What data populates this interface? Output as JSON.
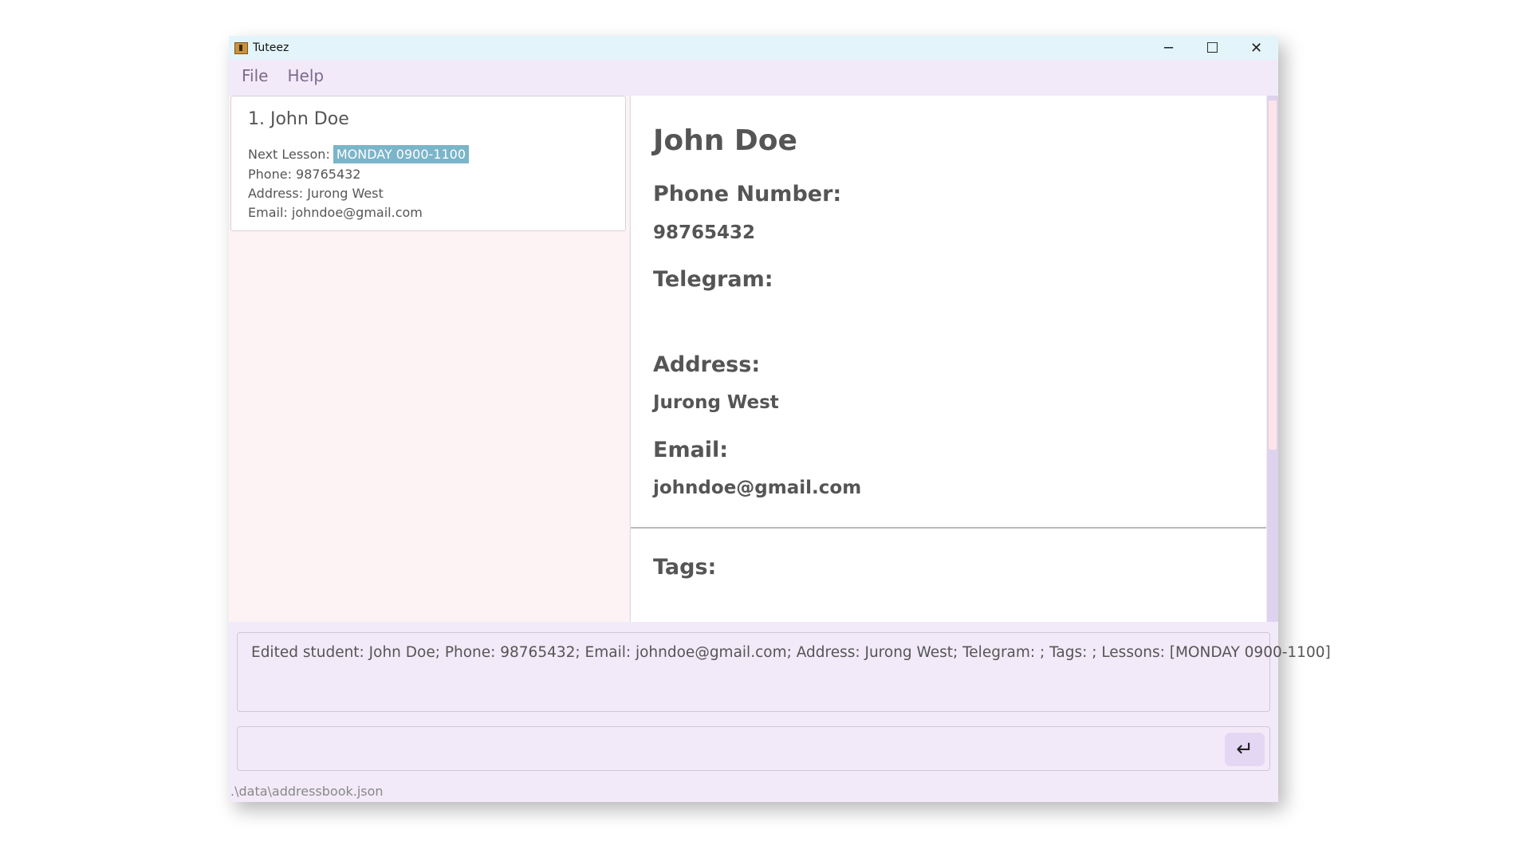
{
  "window": {
    "title": "Tuteez",
    "controls": {
      "minimize": "─",
      "maximize": "☐",
      "close": "✕"
    }
  },
  "menu": {
    "file": "File",
    "help": "Help"
  },
  "list": {
    "items": [
      {
        "name": "1. John Doe",
        "next_lesson_label": "Next Lesson:",
        "next_lesson": "MONDAY 0900-1100",
        "phone": "Phone: 98765432",
        "address": "Address: Jurong West",
        "email": "Email: johndoe@gmail.com"
      }
    ]
  },
  "detail": {
    "name": "John Doe",
    "phone_label": "Phone Number:",
    "phone_value": "98765432",
    "telegram_label": "Telegram:",
    "telegram_value": "",
    "address_label": "Address:",
    "address_value": "Jurong West",
    "email_label": "Email:",
    "email_value": "johndoe@gmail.com",
    "tags_label": "Tags:"
  },
  "result": {
    "text": "Edited student: John Doe; Phone: 98765432; Email: johndoe@gmail.com; Address: Jurong West; Telegram: ; Tags: ; Lessons: [MONDAY 0900-1100]"
  },
  "command": {
    "value": "",
    "enter_icon": "↵"
  },
  "status": {
    "path": ".\\data\\addressbook.json"
  },
  "colors": {
    "lesson_chip": "#7ab5c9",
    "titlebar": "#e3f5fa",
    "window_bg": "#f2eaf8",
    "list_bg": "#fdf3f4"
  }
}
